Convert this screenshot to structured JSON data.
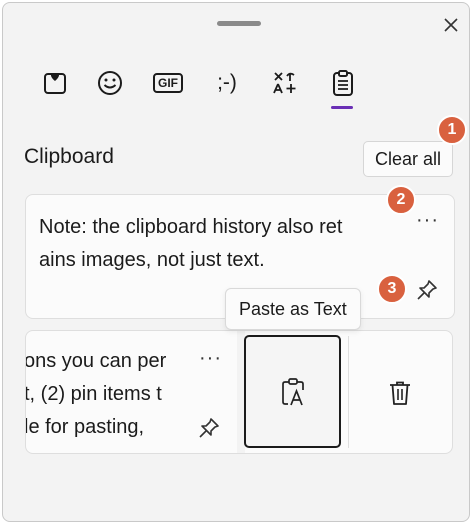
{
  "panel": {
    "close_icon": "close-icon",
    "grip_icon": "drag-grip"
  },
  "tabs": [
    {
      "name": "most-used",
      "icon": "heart-square-icon"
    },
    {
      "name": "emoji",
      "icon": "smiley-icon"
    },
    {
      "name": "gif",
      "icon": "gif-icon",
      "label": "GIF"
    },
    {
      "name": "kaomoji",
      "icon": "kaomoji-icon",
      "label": ";-)"
    },
    {
      "name": "symbols",
      "icon": "symbols-icon"
    },
    {
      "name": "clipboard",
      "icon": "clipboard-icon",
      "selected": true
    }
  ],
  "clipboard": {
    "title": "Clipboard",
    "clear_all_label": "Clear all",
    "items": [
      {
        "lines": [
          "Note: the clipboard history also ret",
          "ains images, not just text."
        ],
        "more_label": "···"
      },
      {
        "lines": [
          "ons you can per",
          "t, (2) pin items t",
          "le for pasting,"
        ],
        "more_label": "···"
      }
    ],
    "paste_as_text_tooltip": "Paste as Text"
  },
  "badges": [
    "1",
    "2",
    "3"
  ],
  "colors": {
    "accent": "#6a2fb5",
    "badge": "#d9613f",
    "panel_bg": "#f3f3f3"
  }
}
